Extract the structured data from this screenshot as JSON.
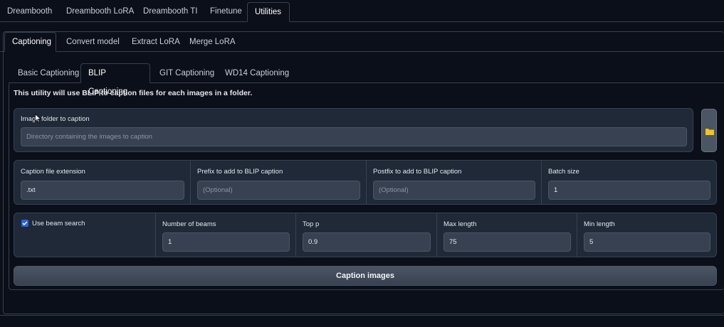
{
  "top_tabs": [
    "Dreambooth",
    "Dreambooth LoRA",
    "Dreambooth TI",
    "Finetune",
    "Utilities"
  ],
  "utility_tabs": [
    "Captioning",
    "Convert model",
    "Extract LoRA",
    "Merge LoRA"
  ],
  "caption_tabs": [
    "Basic Captioning",
    "BLIP Captioning",
    "GIT Captioning",
    "WD14 Captioning"
  ],
  "description": "This utility will use BLIP to caption files for each images in a folder.",
  "image_folder": {
    "label": "Image folder to caption",
    "placeholder": "Directory containing the images to caption"
  },
  "row1": {
    "ext_label": "Caption file extension",
    "ext_value": ".txt",
    "prefix_label": "Prefix to add to BLIP caption",
    "prefix_placeholder": "(Optional)",
    "postfix_label": "Postfix to add to BLIP caption",
    "postfix_placeholder": "(Optional)",
    "batch_label": "Batch size",
    "batch_value": "1"
  },
  "row2": {
    "beam_label": "Use beam search",
    "beam_checked": true,
    "num_beams_label": "Number of beams",
    "num_beams_value": "1",
    "top_p_label": "Top p",
    "top_p_value": "0.9",
    "max_len_label": "Max length",
    "max_len_value": "75",
    "min_len_label": "Min length",
    "min_len_value": "5"
  },
  "caption_button": "Caption images",
  "icons": {
    "folder": "folder-icon",
    "checkbox": "check-icon"
  },
  "colors": {
    "background": "#0b0f19",
    "panel": "#1f2937",
    "input": "#374151",
    "accent": "#2563eb",
    "folder": "#f5c518"
  }
}
